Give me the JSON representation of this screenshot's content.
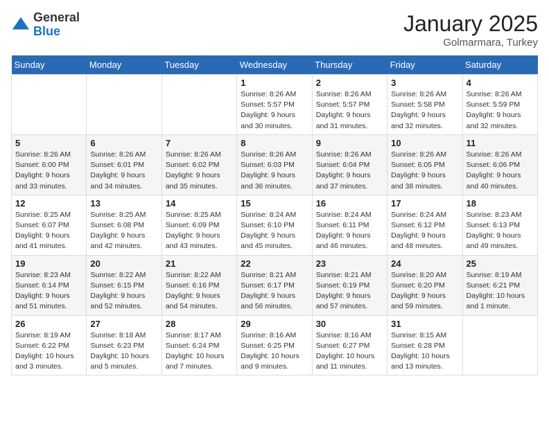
{
  "header": {
    "logo_general": "General",
    "logo_blue": "Blue",
    "month": "January 2025",
    "location": "Golmarmara, Turkey"
  },
  "days_of_week": [
    "Sunday",
    "Monday",
    "Tuesday",
    "Wednesday",
    "Thursday",
    "Friday",
    "Saturday"
  ],
  "weeks": [
    [
      {
        "day": "",
        "text": ""
      },
      {
        "day": "",
        "text": ""
      },
      {
        "day": "",
        "text": ""
      },
      {
        "day": "1",
        "text": "Sunrise: 8:26 AM\nSunset: 5:57 PM\nDaylight: 9 hours\nand 30 minutes."
      },
      {
        "day": "2",
        "text": "Sunrise: 8:26 AM\nSunset: 5:57 PM\nDaylight: 9 hours\nand 31 minutes."
      },
      {
        "day": "3",
        "text": "Sunrise: 8:26 AM\nSunset: 5:58 PM\nDaylight: 9 hours\nand 32 minutes."
      },
      {
        "day": "4",
        "text": "Sunrise: 8:26 AM\nSunset: 5:59 PM\nDaylight: 9 hours\nand 32 minutes."
      }
    ],
    [
      {
        "day": "5",
        "text": "Sunrise: 8:26 AM\nSunset: 6:00 PM\nDaylight: 9 hours\nand 33 minutes."
      },
      {
        "day": "6",
        "text": "Sunrise: 8:26 AM\nSunset: 6:01 PM\nDaylight: 9 hours\nand 34 minutes."
      },
      {
        "day": "7",
        "text": "Sunrise: 8:26 AM\nSunset: 6:02 PM\nDaylight: 9 hours\nand 35 minutes."
      },
      {
        "day": "8",
        "text": "Sunrise: 8:26 AM\nSunset: 6:03 PM\nDaylight: 9 hours\nand 36 minutes."
      },
      {
        "day": "9",
        "text": "Sunrise: 8:26 AM\nSunset: 6:04 PM\nDaylight: 9 hours\nand 37 minutes."
      },
      {
        "day": "10",
        "text": "Sunrise: 8:26 AM\nSunset: 6:05 PM\nDaylight: 9 hours\nand 38 minutes."
      },
      {
        "day": "11",
        "text": "Sunrise: 8:26 AM\nSunset: 6:06 PM\nDaylight: 9 hours\nand 40 minutes."
      }
    ],
    [
      {
        "day": "12",
        "text": "Sunrise: 8:25 AM\nSunset: 6:07 PM\nDaylight: 9 hours\nand 41 minutes."
      },
      {
        "day": "13",
        "text": "Sunrise: 8:25 AM\nSunset: 6:08 PM\nDaylight: 9 hours\nand 42 minutes."
      },
      {
        "day": "14",
        "text": "Sunrise: 8:25 AM\nSunset: 6:09 PM\nDaylight: 9 hours\nand 43 minutes."
      },
      {
        "day": "15",
        "text": "Sunrise: 8:24 AM\nSunset: 6:10 PM\nDaylight: 9 hours\nand 45 minutes."
      },
      {
        "day": "16",
        "text": "Sunrise: 8:24 AM\nSunset: 6:11 PM\nDaylight: 9 hours\nand 46 minutes."
      },
      {
        "day": "17",
        "text": "Sunrise: 8:24 AM\nSunset: 6:12 PM\nDaylight: 9 hours\nand 48 minutes."
      },
      {
        "day": "18",
        "text": "Sunrise: 8:23 AM\nSunset: 6:13 PM\nDaylight: 9 hours\nand 49 minutes."
      }
    ],
    [
      {
        "day": "19",
        "text": "Sunrise: 8:23 AM\nSunset: 6:14 PM\nDaylight: 9 hours\nand 51 minutes."
      },
      {
        "day": "20",
        "text": "Sunrise: 8:22 AM\nSunset: 6:15 PM\nDaylight: 9 hours\nand 52 minutes."
      },
      {
        "day": "21",
        "text": "Sunrise: 8:22 AM\nSunset: 6:16 PM\nDaylight: 9 hours\nand 54 minutes."
      },
      {
        "day": "22",
        "text": "Sunrise: 8:21 AM\nSunset: 6:17 PM\nDaylight: 9 hours\nand 56 minutes."
      },
      {
        "day": "23",
        "text": "Sunrise: 8:21 AM\nSunset: 6:19 PM\nDaylight: 9 hours\nand 57 minutes."
      },
      {
        "day": "24",
        "text": "Sunrise: 8:20 AM\nSunset: 6:20 PM\nDaylight: 9 hours\nand 59 minutes."
      },
      {
        "day": "25",
        "text": "Sunrise: 8:19 AM\nSunset: 6:21 PM\nDaylight: 10 hours\nand 1 minute."
      }
    ],
    [
      {
        "day": "26",
        "text": "Sunrise: 8:19 AM\nSunset: 6:22 PM\nDaylight: 10 hours\nand 3 minutes."
      },
      {
        "day": "27",
        "text": "Sunrise: 8:18 AM\nSunset: 6:23 PM\nDaylight: 10 hours\nand 5 minutes."
      },
      {
        "day": "28",
        "text": "Sunrise: 8:17 AM\nSunset: 6:24 PM\nDaylight: 10 hours\nand 7 minutes."
      },
      {
        "day": "29",
        "text": "Sunrise: 8:16 AM\nSunset: 6:25 PM\nDaylight: 10 hours\nand 9 minutes."
      },
      {
        "day": "30",
        "text": "Sunrise: 8:16 AM\nSunset: 6:27 PM\nDaylight: 10 hours\nand 11 minutes."
      },
      {
        "day": "31",
        "text": "Sunrise: 8:15 AM\nSunset: 6:28 PM\nDaylight: 10 hours\nand 13 minutes."
      },
      {
        "day": "",
        "text": ""
      }
    ]
  ]
}
